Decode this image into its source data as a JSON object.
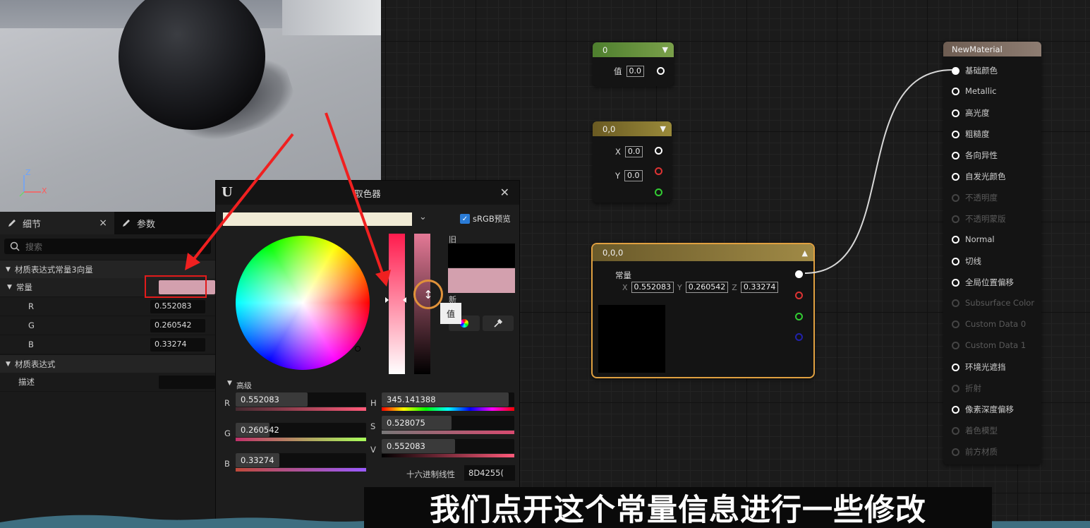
{
  "viewport": {
    "axis_z": "Z",
    "axis_x": "X"
  },
  "details": {
    "tabs": [
      {
        "label": "细节",
        "icon": "pencil-icon",
        "close": "×"
      },
      {
        "label": "参数",
        "icon": "pencil-icon"
      }
    ],
    "search_placeholder": "搜索",
    "section1": "材质表达式常量3向量",
    "constant_label": "常量",
    "channels": [
      {
        "label": "R",
        "value": "0.552083"
      },
      {
        "label": "G",
        "value": "0.260542"
      },
      {
        "label": "B",
        "value": "0.33274"
      }
    ],
    "section2": "材质表达式",
    "desc_label": "描述"
  },
  "picker": {
    "title": "取色器",
    "logo": "U",
    "close": "✕",
    "srgb_label": "sRGB预览",
    "old_label": "旧",
    "new_label": "新",
    "tooltip": "值",
    "advanced_label": "高级",
    "rgb": [
      {
        "letter": "R",
        "value": "0.552083",
        "fraction": 0.552083
      },
      {
        "letter": "G",
        "value": "0.260542",
        "fraction": 0.260542
      },
      {
        "letter": "B",
        "value": "0.33274",
        "fraction": 0.33274
      }
    ],
    "hsv": [
      {
        "letter": "H",
        "value": "345.141388",
        "fraction": 0.9587
      },
      {
        "letter": "S",
        "value": "0.528075",
        "fraction": 0.528075
      },
      {
        "letter": "V",
        "value": "0.552083",
        "fraction": 0.552083
      }
    ],
    "hex_label": "十六进制线性",
    "hex_value": "8D4255(",
    "colors": {
      "new": "#d3a0ae",
      "old": "#000000",
      "top_bar": "#f1ebd6"
    }
  },
  "nodes": {
    "scalar": {
      "title": "0",
      "pin_label": "值",
      "value": "0.0",
      "color": "#5a8a3a"
    },
    "vec2": {
      "title": "0,0",
      "x_label": "X",
      "x_value": "0.0",
      "y_label": "Y",
      "y_value": "0.0",
      "color": "#7a6a2a"
    },
    "vec3": {
      "title": "0,0,0",
      "label": "常量",
      "x_label": "X",
      "x_value": "0.552083",
      "y_label": "Y",
      "y_value": "0.260542",
      "z_label": "Z",
      "z_value": "0.33274",
      "color": "#8a7a3a",
      "accent": "#e0a040"
    },
    "material": {
      "title": "NewMaterial",
      "pins": [
        {
          "label": "基础颜色",
          "active": true,
          "connected": true
        },
        {
          "label": "Metallic",
          "active": true
        },
        {
          "label": "高光度",
          "active": true
        },
        {
          "label": "粗糙度",
          "active": true
        },
        {
          "label": "各向异性",
          "active": true
        },
        {
          "label": "自发光颜色",
          "active": true
        },
        {
          "label": "不透明度",
          "active": false
        },
        {
          "label": "不透明蒙版",
          "active": false
        },
        {
          "label": "Normal",
          "active": true
        },
        {
          "label": "切线",
          "active": true
        },
        {
          "label": "全局位置偏移",
          "active": true
        },
        {
          "label": "Subsurface Color",
          "active": false
        },
        {
          "label": "Custom Data 0",
          "active": false
        },
        {
          "label": "Custom Data 1",
          "active": false
        },
        {
          "label": "环境光遮挡",
          "active": true
        },
        {
          "label": "折射",
          "active": false
        },
        {
          "label": "像素深度偏移",
          "active": true
        },
        {
          "label": "着色模型",
          "active": false
        },
        {
          "label": "前方材质",
          "active": false
        }
      ]
    }
  },
  "subtitle": "我们点开这个常量信息进行一些修改"
}
